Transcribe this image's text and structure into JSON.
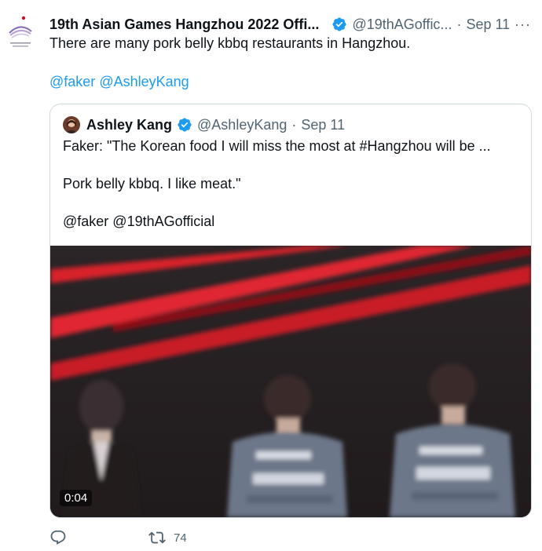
{
  "tweet": {
    "author_name": "19th Asian Games Hangzhou 2022 Offi...",
    "handle": "@19thAGoffic...",
    "separator": "·",
    "date": "Sep 11",
    "more": "···",
    "text": "There are many pork belly kbbq restaurants in Hangzhou.",
    "mentions": [
      "@faker",
      "@AshleyKang"
    ]
  },
  "quote": {
    "author_name": "Ashley Kang",
    "handle": "@AshleyKang",
    "separator": "·",
    "date": "Sep 11",
    "line1": "Faker: \"The Korean food I will miss the most at #Hangzhou will be ...",
    "line2": "Pork belly kbbq. I like meat.\"",
    "line3": "@faker @19thAGofficial",
    "video_timestamp": "0:04"
  },
  "actions": {
    "retweet_count": "74"
  },
  "icons": {
    "avatar": "hangzhou-asian-games-logo-icon",
    "verified": "verified-badge-icon",
    "reply": "reply-icon",
    "retweet": "retweet-icon",
    "more": "more-icon"
  },
  "colors": {
    "link": "#1d9bf0",
    "verified": "#1d9bf0",
    "muted": "#536471",
    "text": "#0f1419"
  }
}
